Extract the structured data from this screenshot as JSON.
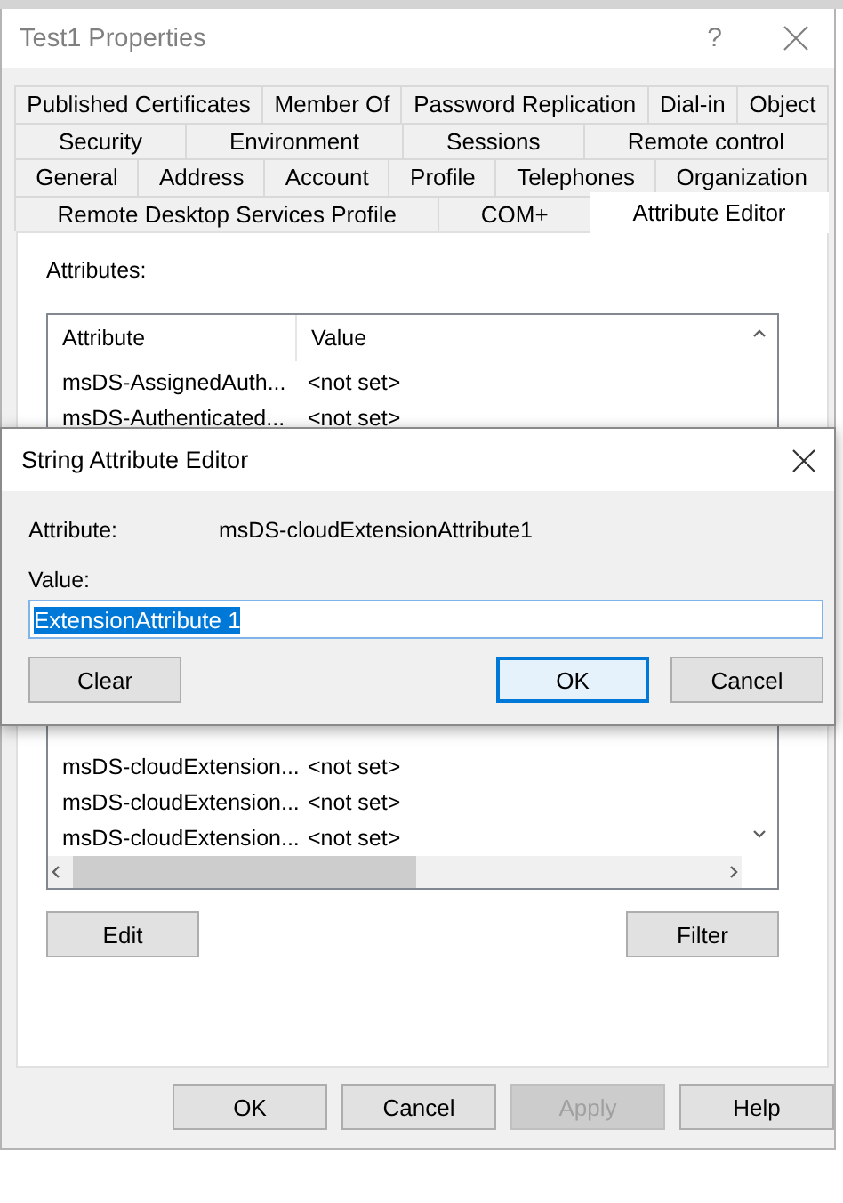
{
  "window": {
    "title": "Test1 Properties",
    "help": "?"
  },
  "tab_rows": [
    [
      {
        "label": "Published Certificates",
        "selected": false
      },
      {
        "label": "Member Of",
        "selected": false
      },
      {
        "label": "Password Replication",
        "selected": false
      },
      {
        "label": "Dial-in",
        "selected": false
      },
      {
        "label": "Object",
        "selected": false
      }
    ],
    [
      {
        "label": "Security",
        "selected": false
      },
      {
        "label": "Environment",
        "selected": false
      },
      {
        "label": "Sessions",
        "selected": false
      },
      {
        "label": "Remote control",
        "selected": false
      }
    ],
    [
      {
        "label": "General",
        "selected": false
      },
      {
        "label": "Address",
        "selected": false
      },
      {
        "label": "Account",
        "selected": false
      },
      {
        "label": "Profile",
        "selected": false
      },
      {
        "label": "Telephones",
        "selected": false
      },
      {
        "label": "Organization",
        "selected": false
      }
    ],
    [
      {
        "label": "Remote Desktop Services Profile",
        "selected": false
      },
      {
        "label": "COM+",
        "selected": false
      },
      {
        "label": "Attribute Editor",
        "selected": true
      }
    ]
  ],
  "attributes_label": "Attributes:",
  "table": {
    "columns": [
      "Attribute",
      "Value"
    ],
    "rows": [
      {
        "attribute": "msDS-AssignedAuth...",
        "value": "<not set>"
      },
      {
        "attribute": "msDS-Authenticated...",
        "value": "<not set>"
      },
      {
        "attribute": "msDS-cloudExtension...",
        "value": "<not set>"
      },
      {
        "attribute": "msDS-cloudExtension...",
        "value": "<not set>"
      },
      {
        "attribute": "msDS-cloudExtension...",
        "value": "<not set>"
      }
    ]
  },
  "list_buttons": [
    {
      "label": "Edit"
    },
    {
      "label": "Filter"
    }
  ],
  "buttons": [
    {
      "label": "OK",
      "disabled": false
    },
    {
      "label": "Cancel",
      "disabled": false
    },
    {
      "label": "Apply",
      "disabled": true
    },
    {
      "label": "Help",
      "disabled": false
    }
  ],
  "dialog": {
    "title": "String Attribute Editor",
    "attribute_label": "Attribute:",
    "attribute": "msDS-cloudExtensionAttribute1",
    "value_label": "Value:",
    "value": "ExtensionAttribute 1",
    "value_selected": true,
    "buttons": [
      {
        "label": "Clear",
        "default": false
      },
      {
        "label": "OK",
        "default": true
      },
      {
        "label": "Cancel",
        "default": false
      }
    ]
  }
}
